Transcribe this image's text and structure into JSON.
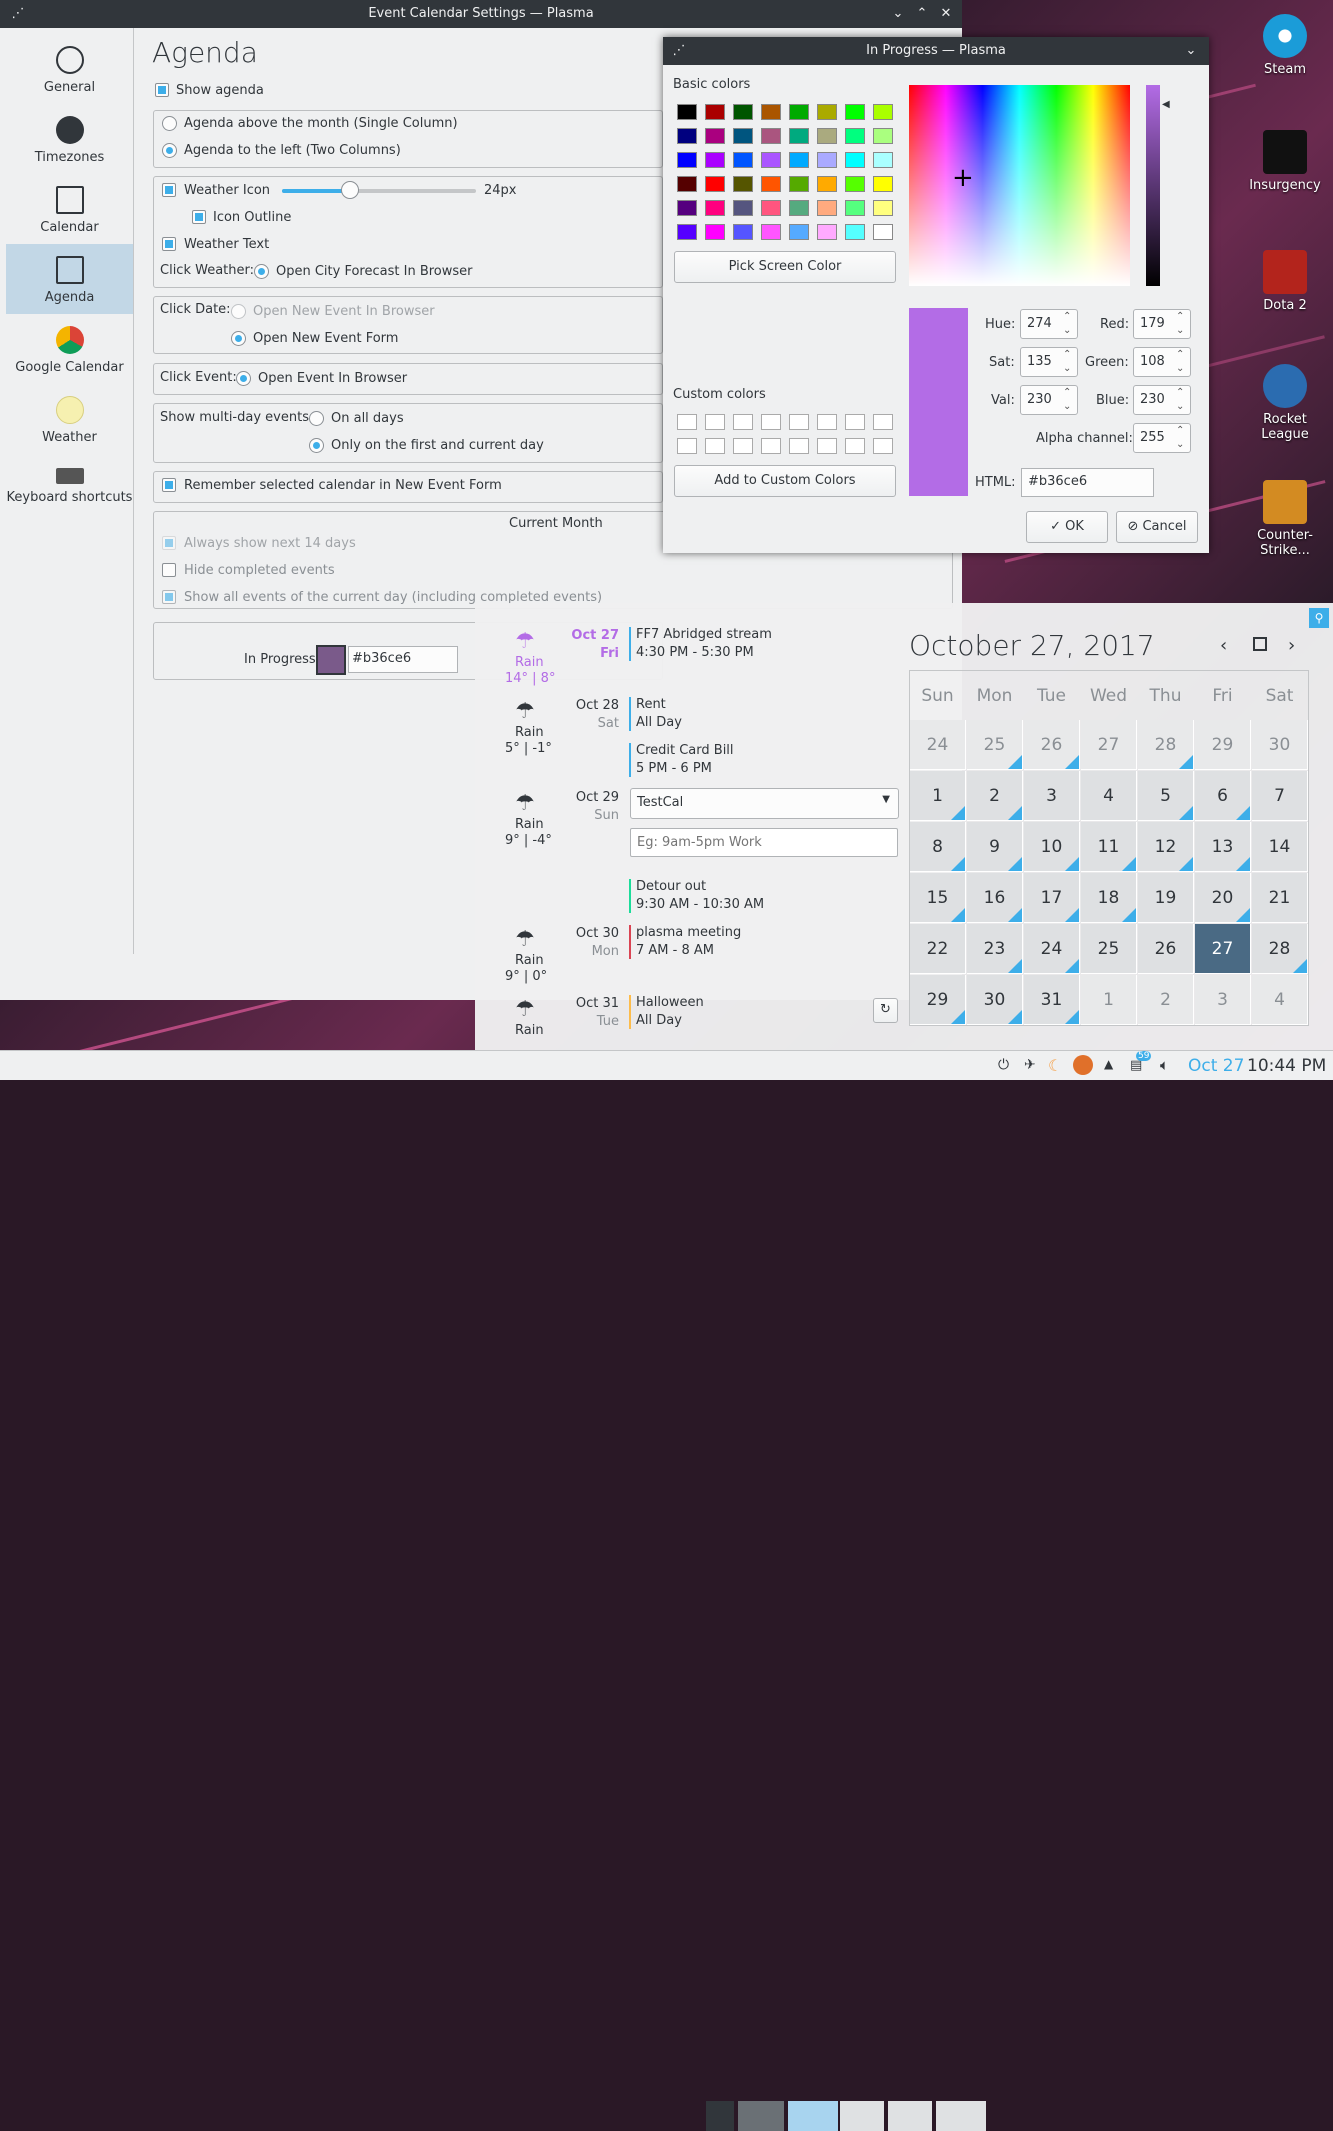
{
  "settings_window": {
    "title": "Event Calendar Settings — Plasma",
    "page_title": "Agenda",
    "sidebar": [
      {
        "label": "General",
        "icon": "clock-icon"
      },
      {
        "label": "Timezones",
        "icon": "timezone-clock-icon"
      },
      {
        "label": "Calendar",
        "icon": "calendar-icon"
      },
      {
        "label": "Agenda",
        "icon": "agenda-list-icon"
      },
      {
        "label": "Google Calendar",
        "icon": "chrome-icon"
      },
      {
        "label": "Weather",
        "icon": "weather-sun-icon"
      },
      {
        "label": "Keyboard shortcuts",
        "icon": "keyboard-icon"
      }
    ],
    "show_agenda": "Show agenda",
    "agenda_above": "Agenda above the month (Single Column)",
    "agenda_left": "Agenda to the left (Two Columns)",
    "weather_icon": "Weather Icon",
    "weather_icon_size": "24px",
    "weather_icon_slider_level": 0.35,
    "icon_outline": "Icon Outline",
    "weather_text": "Weather Text",
    "click_weather": "Click Weather:",
    "open_city_forecast": "Open City Forecast In Browser",
    "click_date": "Click Date:",
    "open_new_event_browser": "Open New Event In Browser",
    "open_new_event_form": "Open New Event Form",
    "click_event": "Click Event:",
    "open_event_browser": "Open Event In Browser",
    "show_multiday": "Show multi-day events:",
    "on_all_days": "On all days",
    "only_first_current": "Only on the first and current day",
    "remember_calendar": "Remember selected calendar in New Event Form",
    "current_month": "Current Month",
    "always_show_14": "Always show next 14 days",
    "hide_completed": "Hide completed events",
    "show_all_events": "Show all events of the current day (including completed events)",
    "in_progress_label": "In Progress",
    "in_progress_color": "#7a5a8a",
    "in_progress_value": "#b36ce6"
  },
  "color_dialog": {
    "title": "In Progress — Plasma",
    "basic_colors": "Basic colors",
    "swatches": [
      "#000000",
      "#aa0000",
      "#005500",
      "#aa5500",
      "#00aa00",
      "#aaaa00",
      "#00ff00",
      "#aaff00",
      "#00007f",
      "#aa007f",
      "#00557f",
      "#aa557f",
      "#00aa7f",
      "#aaaa7f",
      "#00ff7f",
      "#aaff7f",
      "#0000ff",
      "#aa00ff",
      "#0055ff",
      "#aa55ff",
      "#00aaff",
      "#aaaaff",
      "#00ffff",
      "#aaffff",
      "#550000",
      "#ff0000",
      "#555500",
      "#ff5500",
      "#55aa00",
      "#ffaa00",
      "#55ff00",
      "#ffff00",
      "#55007f",
      "#ff007f",
      "#55557f",
      "#ff557f",
      "#55aa7f",
      "#ffaa7f",
      "#55ff7f",
      "#ffff7f",
      "#5500ff",
      "#ff00ff",
      "#5555ff",
      "#ff55ff",
      "#55aaff",
      "#ffaaff",
      "#55ffff",
      "#ffffff"
    ],
    "pick_screen_color": "Pick Screen Color",
    "custom_colors": "Custom colors",
    "add_custom": "Add to Custom Colors",
    "hue_label": "Hue:",
    "hue": "274",
    "sat_label": "Sat:",
    "sat": "135",
    "val_label": "Val:",
    "val": "230",
    "red_label": "Red:",
    "red": "179",
    "green_label": "Green:",
    "green": "108",
    "blue_label": "Blue:",
    "blue": "230",
    "alpha_label": "Alpha channel:",
    "alpha": "255",
    "html_label": "HTML:",
    "html": "#b36ce6",
    "ok": "OK",
    "cancel": "Cancel",
    "current_color": "#b36ce6"
  },
  "agenda_popup": {
    "date_title": "October 27, 2017",
    "weekdays": [
      "Sun",
      "Mon",
      "Tue",
      "Wed",
      "Thu",
      "Fri",
      "Sat"
    ],
    "days": [
      [
        "24",
        "25",
        "26",
        "27",
        "28",
        "29",
        "30"
      ],
      [
        "1",
        "2",
        "3",
        "4",
        "5",
        "6",
        "7"
      ],
      [
        "8",
        "9",
        "10",
        "11",
        "12",
        "13",
        "14"
      ],
      [
        "15",
        "16",
        "17",
        "18",
        "19",
        "20",
        "21"
      ],
      [
        "22",
        "23",
        "24",
        "25",
        "26",
        "27",
        "28"
      ],
      [
        "29",
        "30",
        "31",
        "1",
        "2",
        "3",
        "4"
      ]
    ],
    "weather": [
      {
        "cond": "Rain",
        "temp": "14° | 8°"
      },
      {
        "cond": "Rain",
        "temp": "5° | -1°"
      },
      {
        "cond": "Rain",
        "temp": "9° | -4°"
      },
      {
        "cond": "Rain",
        "temp": "9° | 0°"
      },
      {
        "cond": "Rain",
        "temp": ""
      }
    ],
    "dates": [
      {
        "d": "Oct 27",
        "w": "Fri"
      },
      {
        "d": "Oct 28",
        "w": "Sat"
      },
      {
        "d": "Oct 29",
        "w": "Sun"
      },
      {
        "d": "Oct 30",
        "w": "Mon"
      },
      {
        "d": "Oct 31",
        "w": "Tue"
      }
    ],
    "events": [
      {
        "title": "FF7 Abridged stream",
        "time": "4:30 PM - 5:30 PM",
        "color": "#3daee9"
      },
      {
        "title": "Rent",
        "time": "All Day",
        "color": "#3daee9"
      },
      {
        "title": "Credit Card Bill",
        "time": "5 PM - 6 PM",
        "color": "#3daee9"
      },
      {
        "title": "Detour out",
        "time": "9:30 AM - 10:30 AM",
        "color": "#1cdc9a"
      },
      {
        "title": "plasma meeting",
        "time": "7 AM - 8 AM",
        "color": "#da4453"
      },
      {
        "title": "Halloween",
        "time": "All Day",
        "color": "#fdbc4b"
      }
    ],
    "calendar_select": "TestCal",
    "new_event_placeholder": "Eg: 9am-5pm Work"
  },
  "desktop": {
    "icons": [
      "Steam",
      "Insurgency",
      "Dota 2",
      "Rocket League",
      "Counter-Strike..."
    ]
  },
  "taskbar": {
    "clock_date": "Oct 27",
    "clock_time": "10:44 PM",
    "badge": "59"
  }
}
